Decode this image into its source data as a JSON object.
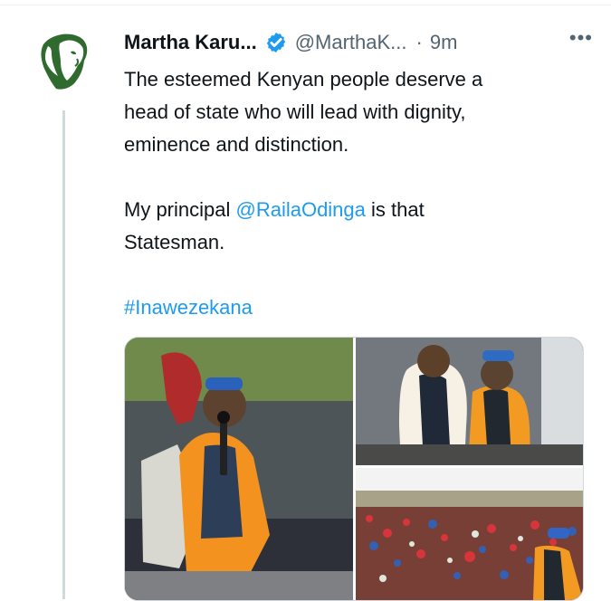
{
  "tweet": {
    "author_name": "Martha Karu...",
    "handle": "@MarthaK...",
    "separator": "·",
    "time": "9m",
    "more_label": "•••",
    "text": {
      "line1": "The esteemed Kenyan people deserve a",
      "line2": "head of state who will lead with dignity,",
      "line3": "eminence and distinction.",
      "line4_prefix": "My principal ",
      "mention": "@RailaOdinga",
      "line4_suffix": " is that",
      "line5": "Statesman.",
      "hashtag": "#Inawezekana"
    }
  },
  "colors": {
    "link": "#1d9bf0",
    "verified_badge": "#1d9bf0",
    "secondary_text": "#536471"
  },
  "icons": {
    "avatar": "green-profile-silhouette",
    "verified": "verified-badge-icon",
    "more": "more-options-icon"
  }
}
